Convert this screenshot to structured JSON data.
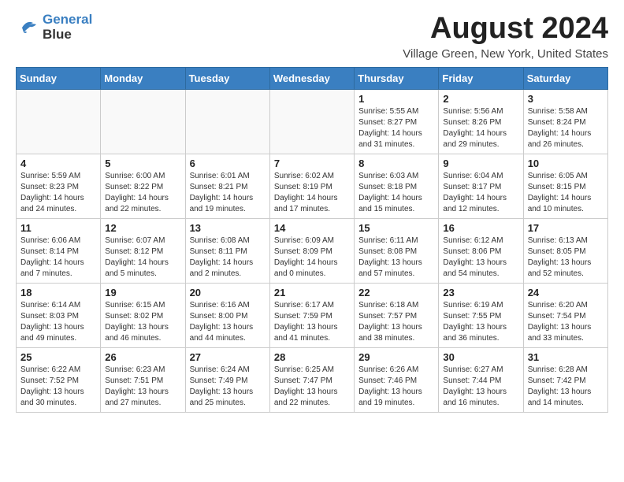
{
  "header": {
    "logo_line1": "General",
    "logo_line2": "Blue",
    "month_year": "August 2024",
    "location": "Village Green, New York, United States"
  },
  "weekdays": [
    "Sunday",
    "Monday",
    "Tuesday",
    "Wednesday",
    "Thursday",
    "Friday",
    "Saturday"
  ],
  "weeks": [
    [
      {
        "day": "",
        "sunrise": "",
        "sunset": "",
        "daylight": ""
      },
      {
        "day": "",
        "sunrise": "",
        "sunset": "",
        "daylight": ""
      },
      {
        "day": "",
        "sunrise": "",
        "sunset": "",
        "daylight": ""
      },
      {
        "day": "",
        "sunrise": "",
        "sunset": "",
        "daylight": ""
      },
      {
        "day": "1",
        "sunrise": "Sunrise: 5:55 AM",
        "sunset": "Sunset: 8:27 PM",
        "daylight": "Daylight: 14 hours and 31 minutes."
      },
      {
        "day": "2",
        "sunrise": "Sunrise: 5:56 AM",
        "sunset": "Sunset: 8:26 PM",
        "daylight": "Daylight: 14 hours and 29 minutes."
      },
      {
        "day": "3",
        "sunrise": "Sunrise: 5:58 AM",
        "sunset": "Sunset: 8:24 PM",
        "daylight": "Daylight: 14 hours and 26 minutes."
      }
    ],
    [
      {
        "day": "4",
        "sunrise": "Sunrise: 5:59 AM",
        "sunset": "Sunset: 8:23 PM",
        "daylight": "Daylight: 14 hours and 24 minutes."
      },
      {
        "day": "5",
        "sunrise": "Sunrise: 6:00 AM",
        "sunset": "Sunset: 8:22 PM",
        "daylight": "Daylight: 14 hours and 22 minutes."
      },
      {
        "day": "6",
        "sunrise": "Sunrise: 6:01 AM",
        "sunset": "Sunset: 8:21 PM",
        "daylight": "Daylight: 14 hours and 19 minutes."
      },
      {
        "day": "7",
        "sunrise": "Sunrise: 6:02 AM",
        "sunset": "Sunset: 8:19 PM",
        "daylight": "Daylight: 14 hours and 17 minutes."
      },
      {
        "day": "8",
        "sunrise": "Sunrise: 6:03 AM",
        "sunset": "Sunset: 8:18 PM",
        "daylight": "Daylight: 14 hours and 15 minutes."
      },
      {
        "day": "9",
        "sunrise": "Sunrise: 6:04 AM",
        "sunset": "Sunset: 8:17 PM",
        "daylight": "Daylight: 14 hours and 12 minutes."
      },
      {
        "day": "10",
        "sunrise": "Sunrise: 6:05 AM",
        "sunset": "Sunset: 8:15 PM",
        "daylight": "Daylight: 14 hours and 10 minutes."
      }
    ],
    [
      {
        "day": "11",
        "sunrise": "Sunrise: 6:06 AM",
        "sunset": "Sunset: 8:14 PM",
        "daylight": "Daylight: 14 hours and 7 minutes."
      },
      {
        "day": "12",
        "sunrise": "Sunrise: 6:07 AM",
        "sunset": "Sunset: 8:12 PM",
        "daylight": "Daylight: 14 hours and 5 minutes."
      },
      {
        "day": "13",
        "sunrise": "Sunrise: 6:08 AM",
        "sunset": "Sunset: 8:11 PM",
        "daylight": "Daylight: 14 hours and 2 minutes."
      },
      {
        "day": "14",
        "sunrise": "Sunrise: 6:09 AM",
        "sunset": "Sunset: 8:09 PM",
        "daylight": "Daylight: 14 hours and 0 minutes."
      },
      {
        "day": "15",
        "sunrise": "Sunrise: 6:11 AM",
        "sunset": "Sunset: 8:08 PM",
        "daylight": "Daylight: 13 hours and 57 minutes."
      },
      {
        "day": "16",
        "sunrise": "Sunrise: 6:12 AM",
        "sunset": "Sunset: 8:06 PM",
        "daylight": "Daylight: 13 hours and 54 minutes."
      },
      {
        "day": "17",
        "sunrise": "Sunrise: 6:13 AM",
        "sunset": "Sunset: 8:05 PM",
        "daylight": "Daylight: 13 hours and 52 minutes."
      }
    ],
    [
      {
        "day": "18",
        "sunrise": "Sunrise: 6:14 AM",
        "sunset": "Sunset: 8:03 PM",
        "daylight": "Daylight: 13 hours and 49 minutes."
      },
      {
        "day": "19",
        "sunrise": "Sunrise: 6:15 AM",
        "sunset": "Sunset: 8:02 PM",
        "daylight": "Daylight: 13 hours and 46 minutes."
      },
      {
        "day": "20",
        "sunrise": "Sunrise: 6:16 AM",
        "sunset": "Sunset: 8:00 PM",
        "daylight": "Daylight: 13 hours and 44 minutes."
      },
      {
        "day": "21",
        "sunrise": "Sunrise: 6:17 AM",
        "sunset": "Sunset: 7:59 PM",
        "daylight": "Daylight: 13 hours and 41 minutes."
      },
      {
        "day": "22",
        "sunrise": "Sunrise: 6:18 AM",
        "sunset": "Sunset: 7:57 PM",
        "daylight": "Daylight: 13 hours and 38 minutes."
      },
      {
        "day": "23",
        "sunrise": "Sunrise: 6:19 AM",
        "sunset": "Sunset: 7:55 PM",
        "daylight": "Daylight: 13 hours and 36 minutes."
      },
      {
        "day": "24",
        "sunrise": "Sunrise: 6:20 AM",
        "sunset": "Sunset: 7:54 PM",
        "daylight": "Daylight: 13 hours and 33 minutes."
      }
    ],
    [
      {
        "day": "25",
        "sunrise": "Sunrise: 6:22 AM",
        "sunset": "Sunset: 7:52 PM",
        "daylight": "Daylight: 13 hours and 30 minutes."
      },
      {
        "day": "26",
        "sunrise": "Sunrise: 6:23 AM",
        "sunset": "Sunset: 7:51 PM",
        "daylight": "Daylight: 13 hours and 27 minutes."
      },
      {
        "day": "27",
        "sunrise": "Sunrise: 6:24 AM",
        "sunset": "Sunset: 7:49 PM",
        "daylight": "Daylight: 13 hours and 25 minutes."
      },
      {
        "day": "28",
        "sunrise": "Sunrise: 6:25 AM",
        "sunset": "Sunset: 7:47 PM",
        "daylight": "Daylight: 13 hours and 22 minutes."
      },
      {
        "day": "29",
        "sunrise": "Sunrise: 6:26 AM",
        "sunset": "Sunset: 7:46 PM",
        "daylight": "Daylight: 13 hours and 19 minutes."
      },
      {
        "day": "30",
        "sunrise": "Sunrise: 6:27 AM",
        "sunset": "Sunset: 7:44 PM",
        "daylight": "Daylight: 13 hours and 16 minutes."
      },
      {
        "day": "31",
        "sunrise": "Sunrise: 6:28 AM",
        "sunset": "Sunset: 7:42 PM",
        "daylight": "Daylight: 13 hours and 14 minutes."
      }
    ]
  ]
}
